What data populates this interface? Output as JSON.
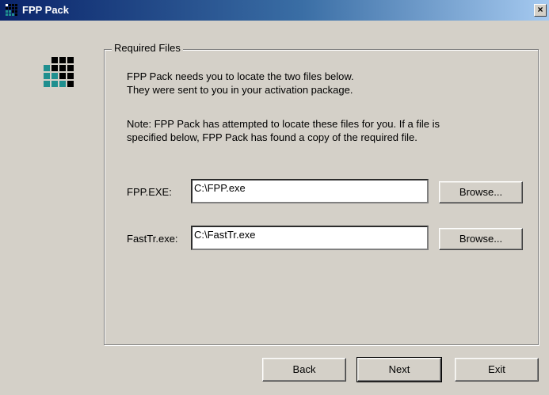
{
  "window": {
    "title": "FPP Pack",
    "close_glyph": "×"
  },
  "group": {
    "legend": "Required Files"
  },
  "intro": {
    "line1": "FPP Pack needs you to locate the two files below.",
    "line2": "They were sent to you in your activation package."
  },
  "note": {
    "line1": "Note:  FPP Pack has attempted to locate these files for you.  If a file is",
    "line2": "specified below, FPP Pack has found a copy of the required file."
  },
  "fields": [
    {
      "label": "FPP.EXE:",
      "value": "C:\\FPP.exe",
      "browse_label": "Browse..."
    },
    {
      "label": "FastTr.exe:",
      "value": "C:\\FastTr.exe",
      "browse_label": "Browse..."
    }
  ],
  "buttons": {
    "back": "Back",
    "next": "Next",
    "exit": "Exit"
  },
  "colors": {
    "titlebar_start": "#0a246a",
    "titlebar_end": "#a6caf0",
    "dialog_bg": "#d4d0c8",
    "logo_dark": "#000000",
    "logo_teal": "#1f8f8f"
  },
  "icons": {
    "app_icon": "fpp-grid-icon",
    "close": "close-icon"
  }
}
